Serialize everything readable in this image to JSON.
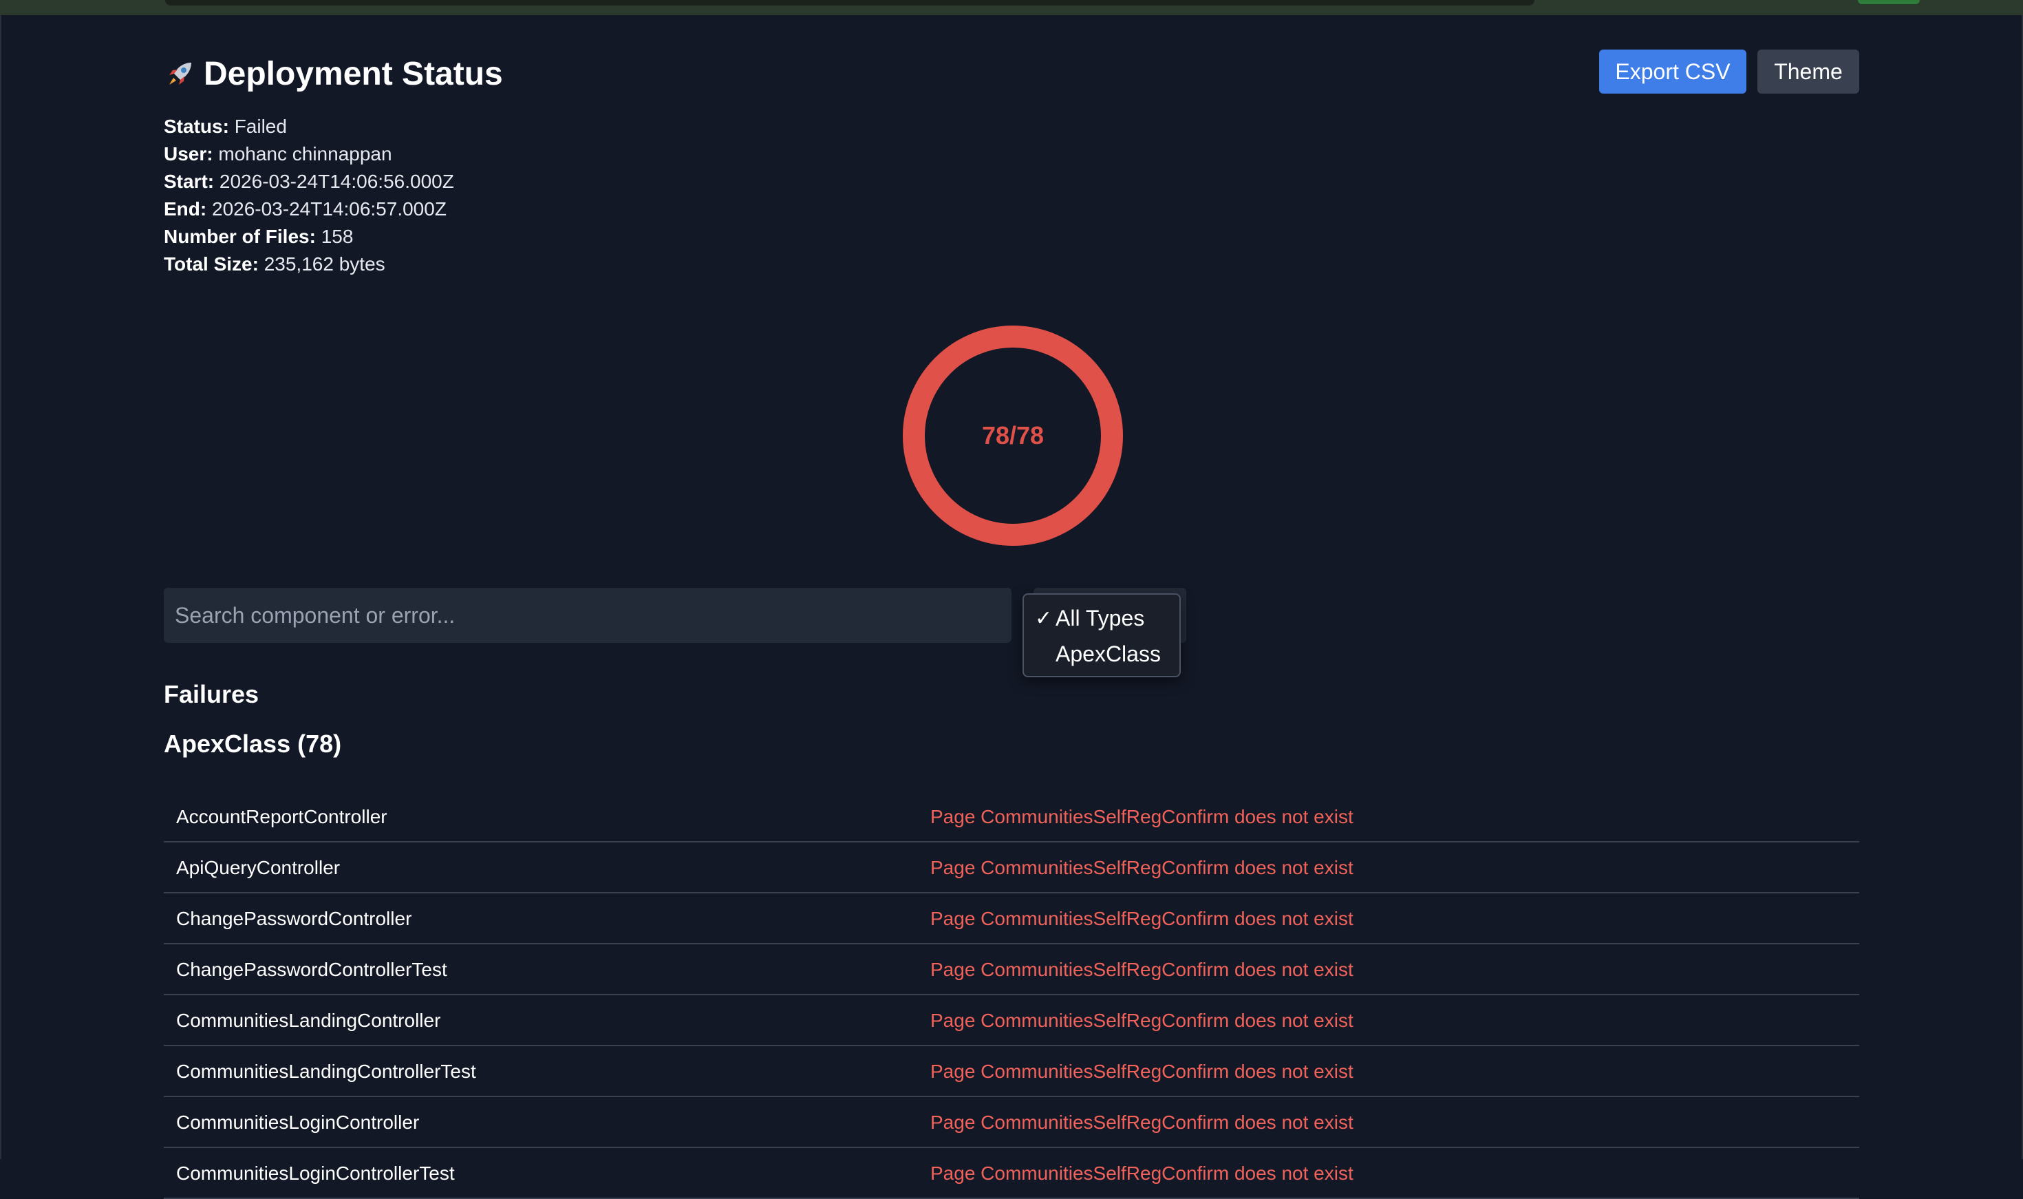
{
  "page": {
    "title": "Deployment Status",
    "accent": "#3f7ee8",
    "error_color": "#e05149"
  },
  "toolbar": {
    "export_label": "Export CSV",
    "theme_label": "Theme"
  },
  "meta": {
    "status_label": "Status:",
    "status_value": "Failed",
    "user_label": "User:",
    "user_value": "mohanc chinnappan",
    "start_label": "Start:",
    "start_value": "2026-03-24T14:06:56.000Z",
    "end_label": "End:",
    "end_value": "2026-03-24T14:06:57.000Z",
    "files_label": "Number of Files:",
    "files_value": "158",
    "size_label": "Total Size:",
    "size_value": "235,162 bytes"
  },
  "progress": {
    "label": "78/78",
    "completed": 78,
    "total": 78
  },
  "search": {
    "placeholder": "Search component or error..."
  },
  "type_filter": {
    "options": [
      "All Types",
      "ApexClass"
    ],
    "selected": "All Types",
    "check_icon": "checkmark-icon"
  },
  "failures": {
    "title": "Failures",
    "group_title": "ApexClass (78)",
    "rows": [
      {
        "name": "AccountReportController",
        "error": "Page CommunitiesSelfRegConfirm does not exist"
      },
      {
        "name": "ApiQueryController",
        "error": "Page CommunitiesSelfRegConfirm does not exist"
      },
      {
        "name": "ChangePasswordController",
        "error": "Page CommunitiesSelfRegConfirm does not exist"
      },
      {
        "name": "ChangePasswordControllerTest",
        "error": "Page CommunitiesSelfRegConfirm does not exist"
      },
      {
        "name": "CommunitiesLandingController",
        "error": "Page CommunitiesSelfRegConfirm does not exist"
      },
      {
        "name": "CommunitiesLandingControllerTest",
        "error": "Page CommunitiesSelfRegConfirm does not exist"
      },
      {
        "name": "CommunitiesLoginController",
        "error": "Page CommunitiesSelfRegConfirm does not exist"
      },
      {
        "name": "CommunitiesLoginControllerTest",
        "error": "Page CommunitiesSelfRegConfirm does not exist"
      }
    ]
  }
}
